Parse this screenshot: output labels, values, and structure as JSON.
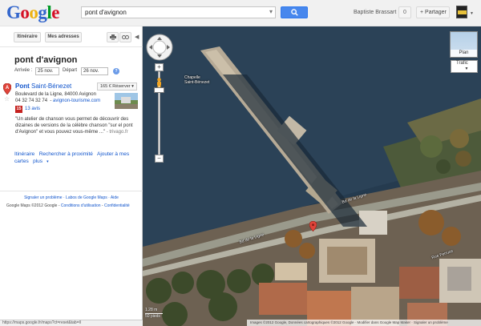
{
  "header": {
    "logo_letters": [
      "G",
      "o",
      "o",
      "g",
      "l",
      "e"
    ],
    "search_value": "pont d'avignon",
    "clear_symbol": "▾",
    "user_name": "Baptiste Brassart",
    "notifications": "0",
    "share_label": "+ Partager",
    "colors": {
      "logo": [
        "#3366cc",
        "#d50f25",
        "#eeb211",
        "#3366cc",
        "#009925",
        "#d50f25"
      ],
      "search_button": "#4787ed"
    }
  },
  "panel": {
    "itinerary_button": "Itinéraire",
    "my_addresses_button": "Mes adresses",
    "print_icon": "print-icon",
    "link_icon": "link-icon",
    "title": "pont d'avignon",
    "arrival_label": "Arrivée :",
    "arrival_date": "25 nov.",
    "departure_label": "Départ",
    "departure_date": "26 nov.",
    "help_symbol": "?",
    "result": {
      "marker_letter": "A",
      "name_bold": "Pont",
      "name_rest": " Saint-Bénezet",
      "reserve": "165 € Réserver ▾",
      "address": "Boulevard de la Ligne, 84000 Avignon",
      "phone": "04 32 74 32 74",
      "website": "avignon-tourisme.com",
      "rating": "15",
      "reviews": "13 avis",
      "snippet": "\"Un atelier de chanson vous permet de découvrir des dizaines de versions de la célèbre chanson \"sur el pont d'Avignon\" et vous pouvez vous-même ...\"",
      "snippet_source": "- trivago.fr"
    },
    "actions": {
      "itinerary": "Itinéraire",
      "nearby": "Rechercher à proximité",
      "add_maps": "Ajouter à mes cartes",
      "more": "plus"
    },
    "footer_links": "Signaler un problème · Labos de Google Maps · Aide",
    "footer_copyright": "Google Maps ©2012 Google",
    "footer_terms": "Conditions d'utilisation",
    "footer_privacy": "Confidentialité",
    "status_url": "https://maps.google.fr/maps?ct=reset&tab=ll"
  },
  "map": {
    "plan_label": "Plan",
    "traffic_label": "Trafic",
    "chapel_label_1": "Chapelle",
    "chapel_label_2": "Saint-Bénezet",
    "roads": [
      "Bd de la Ligne",
      "Bd de la Ligne",
      "Rue Ferruce"
    ],
    "scale_metric": "1.28 m",
    "scale_imperial": "50 pieds",
    "copyright": "Images ©2012 Google, Données cartographiques ©2012 Google  ·  Modifier dans Google Map Maker  ·  Signaler un problème"
  }
}
